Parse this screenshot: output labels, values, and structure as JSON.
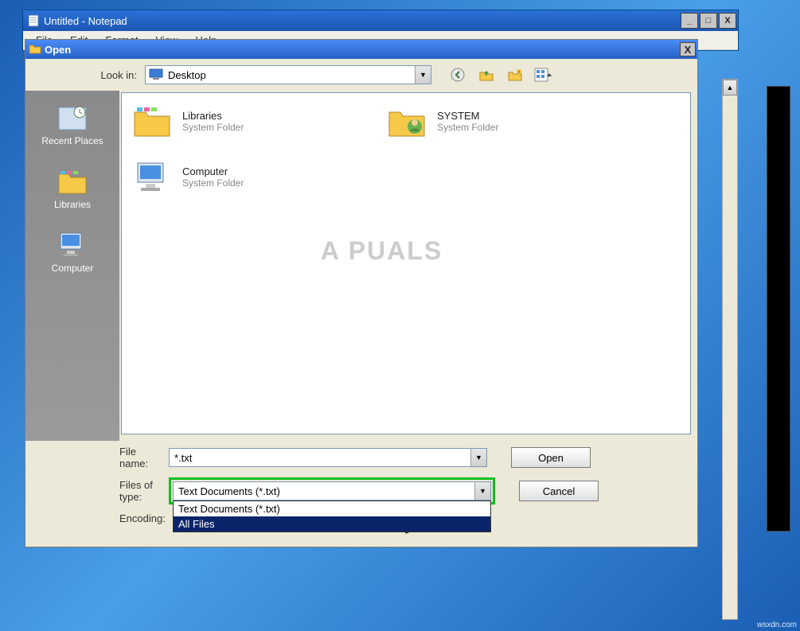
{
  "window": {
    "title": "Untitled - Notepad",
    "minimize": "_",
    "maximize": "□",
    "close": "X"
  },
  "menubar": {
    "file": "File",
    "edit": "Edit",
    "format": "Format",
    "view": "View",
    "help": "Help"
  },
  "dialog": {
    "title": "Open",
    "close": "X",
    "lookin_label": "Look in:",
    "lookin_value": "Desktop",
    "sidebar": {
      "recent": "Recent Places",
      "libraries": "Libraries",
      "computer": "Computer"
    },
    "files": {
      "libraries": {
        "name": "Libraries",
        "desc": "System Folder"
      },
      "system": {
        "name": "SYSTEM",
        "desc": "System Folder"
      },
      "computer": {
        "name": "Computer",
        "desc": "System Folder"
      }
    },
    "filename_label": "File name:",
    "filename_value": "*.txt",
    "filetype_label": "Files of type:",
    "filetype_value": "Text Documents (*.txt)",
    "filetype_options": {
      "opt1": "Text Documents (*.txt)",
      "opt2": "All Files"
    },
    "encoding_label": "Encoding:",
    "open_btn": "Open",
    "cancel_btn": "Cancel"
  },
  "watermark": "A  PUALS",
  "attribution": "wsxdn.com"
}
